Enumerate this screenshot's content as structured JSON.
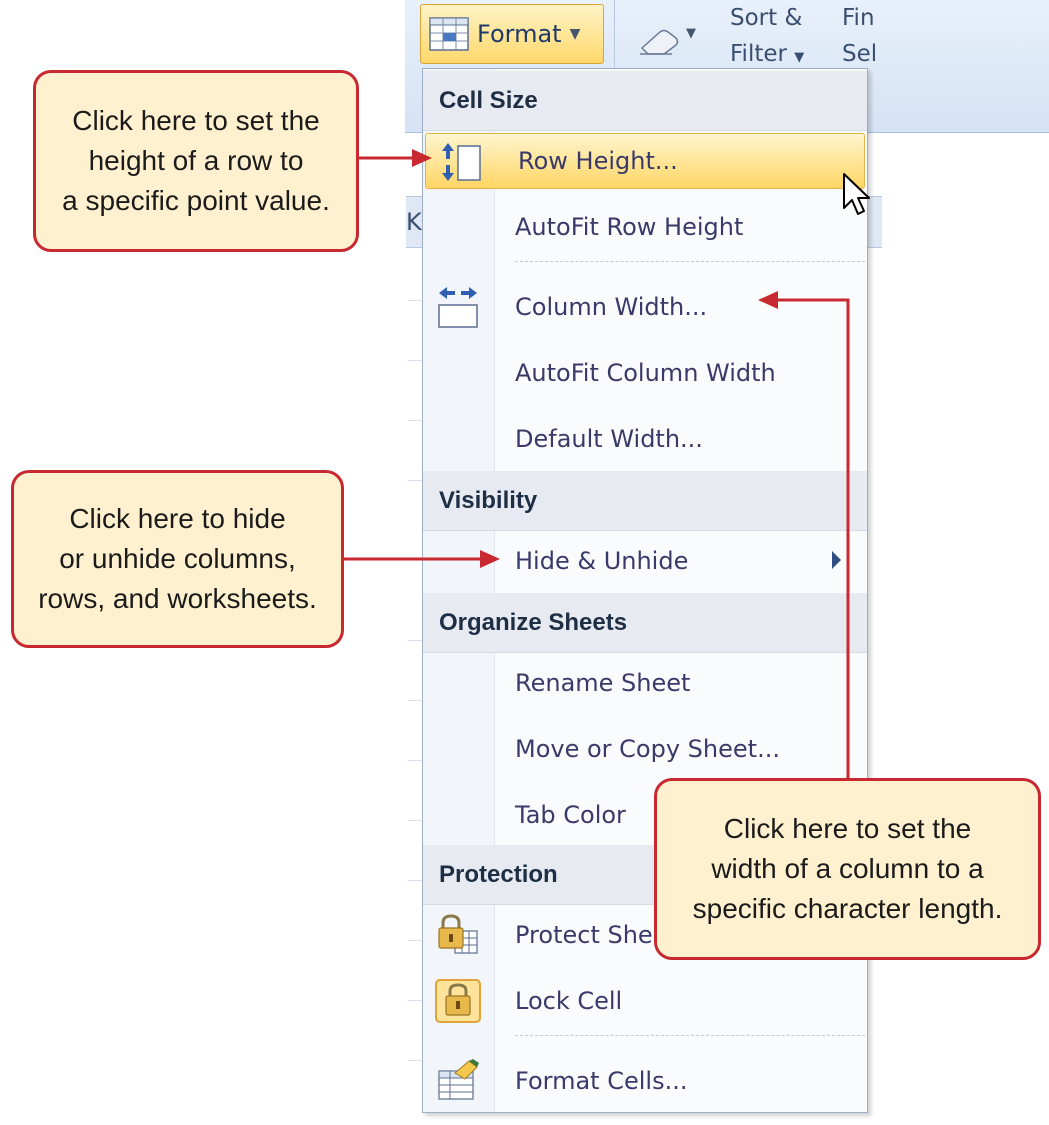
{
  "ribbon": {
    "format_label": "Format",
    "sort_filter_line1": "Sort &",
    "sort_filter_line2": "Filter",
    "find_select_line1": "Fin",
    "find_select_line2": "Sel",
    "column_header_fragment": "K"
  },
  "menu": {
    "sections": {
      "cell_size": "Cell Size",
      "visibility": "Visibility",
      "organize_sheets": "Organize Sheets",
      "protection": "Protection"
    },
    "items": {
      "row_height": "Row Height...",
      "autofit_row_height": "AutoFit Row Height",
      "column_width": "Column Width...",
      "autofit_column_width": "AutoFit Column Width",
      "default_width": "Default Width...",
      "hide_unhide": "Hide & Unhide",
      "rename_sheet": "Rename Sheet",
      "move_copy_sheet": "Move or Copy Sheet...",
      "tab_color": "Tab Color",
      "protect_sheet": "Protect She",
      "lock_cell": "Lock Cell",
      "format_cells": "Format Cells..."
    }
  },
  "callouts": {
    "row_height": {
      "line1": "Click here to set the",
      "line2": "height of a row to",
      "line3": "a specific point value."
    },
    "hide_unhide": {
      "line1": "Click here to hide",
      "line2": "or unhide columns,",
      "line3": "rows, and worksheets."
    },
    "column_width": {
      "line1": "Click here to set the",
      "line2": "width of a column to a",
      "line3": "specific character length."
    }
  },
  "colors": {
    "callout_border": "#c8282f",
    "callout_fill": "#fff1cf",
    "highlight": "#ffd664",
    "menu_text": "#3a3a6a"
  }
}
